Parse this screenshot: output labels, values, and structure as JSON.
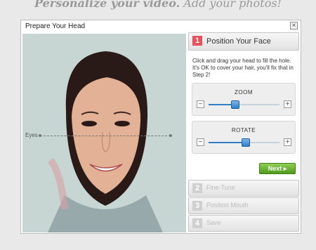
{
  "banner": {
    "bold": "Personalize your video.",
    "rest": " Add your photos!"
  },
  "dialog": {
    "title": "Prepare Your Head",
    "close_icon": "close-icon",
    "eyes_label": "Eyes"
  },
  "steps": [
    {
      "number": "1",
      "label": "Position Your Face",
      "active": true
    },
    {
      "number": "2",
      "label": "Fine-Tune",
      "active": false
    },
    {
      "number": "3",
      "label": "Position Mouth",
      "active": false
    },
    {
      "number": "4",
      "label": "Save",
      "active": false
    }
  ],
  "instructions": "Click and drag your head to fill the hole. It's OK to cover your hair, you'll fix that in Step 2!",
  "zoom": {
    "label": "ZOOM",
    "minus": "−",
    "plus": "+",
    "value": 0.38
  },
  "rotate": {
    "label": "ROTATE",
    "minus": "−",
    "plus": "+",
    "value": 0.52
  },
  "next_button": {
    "label": "Next ▸"
  },
  "colors": {
    "accent_red": "#e8505b",
    "slider_blue": "#2f7fc7",
    "next_green": "#4f9a1c"
  }
}
